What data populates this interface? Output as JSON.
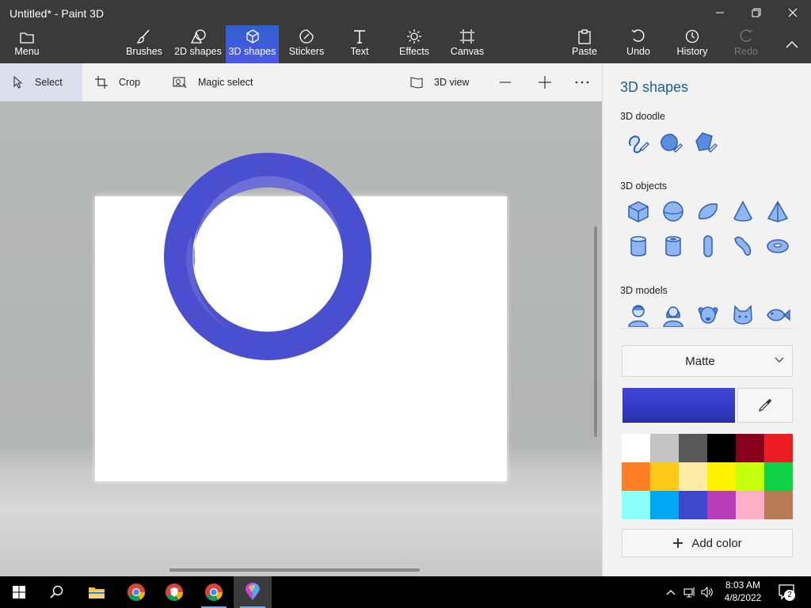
{
  "window": {
    "title": "Untitled* - Paint 3D"
  },
  "toolbar": {
    "menu": "Menu",
    "brushes": "Brushes",
    "shapes2d": "2D shapes",
    "shapes3d": "3D shapes",
    "stickers": "Stickers",
    "text": "Text",
    "effects": "Effects",
    "canvas": "Canvas",
    "paste": "Paste",
    "undo": "Undo",
    "history": "History",
    "redo": "Redo",
    "active_color": "#3f5fe0"
  },
  "subtoolbar": {
    "select": "Select",
    "crop": "Crop",
    "magic_select": "Magic select",
    "view3d": "3D view"
  },
  "canvas": {
    "shape_color": "#4a4fd0",
    "shape_inner_shade": "#6b6fd6"
  },
  "panel": {
    "title": "3D shapes",
    "doodle_heading": "3D doodle",
    "doodles": [
      "sharp-edge-doodle-icon",
      "soft-edge-doodle-icon",
      "tube-doodle-icon"
    ],
    "objects_heading": "3D objects",
    "objects": [
      "cube-icon",
      "sphere-icon",
      "hemisphere-icon",
      "cone-icon",
      "pyramid-icon",
      "cylinder-icon",
      "tube-icon",
      "capsule-icon",
      "curved-tube-icon",
      "donut-icon"
    ],
    "models_heading": "3D models",
    "models": [
      "man-icon",
      "woman-icon",
      "dog-icon",
      "cat-icon",
      "fish-icon"
    ],
    "finish": "Matte",
    "current_color": "#3a3fd0",
    "palette": [
      "#ffffff",
      "#c3c3c3",
      "#585858",
      "#000000",
      "#88001b",
      "#ec1c24",
      "#ff7f27",
      "#ffca18",
      "#fdeca6",
      "#fff200",
      "#c4ff0e",
      "#0ed145",
      "#8cfffb",
      "#00a8f3",
      "#3f48cc",
      "#b83dba",
      "#ffaec8",
      "#b97a56"
    ],
    "add_color": "Add color"
  },
  "taskbar": {
    "time": "8:03 AM",
    "date": "4/8/2022",
    "notifications": "2"
  }
}
